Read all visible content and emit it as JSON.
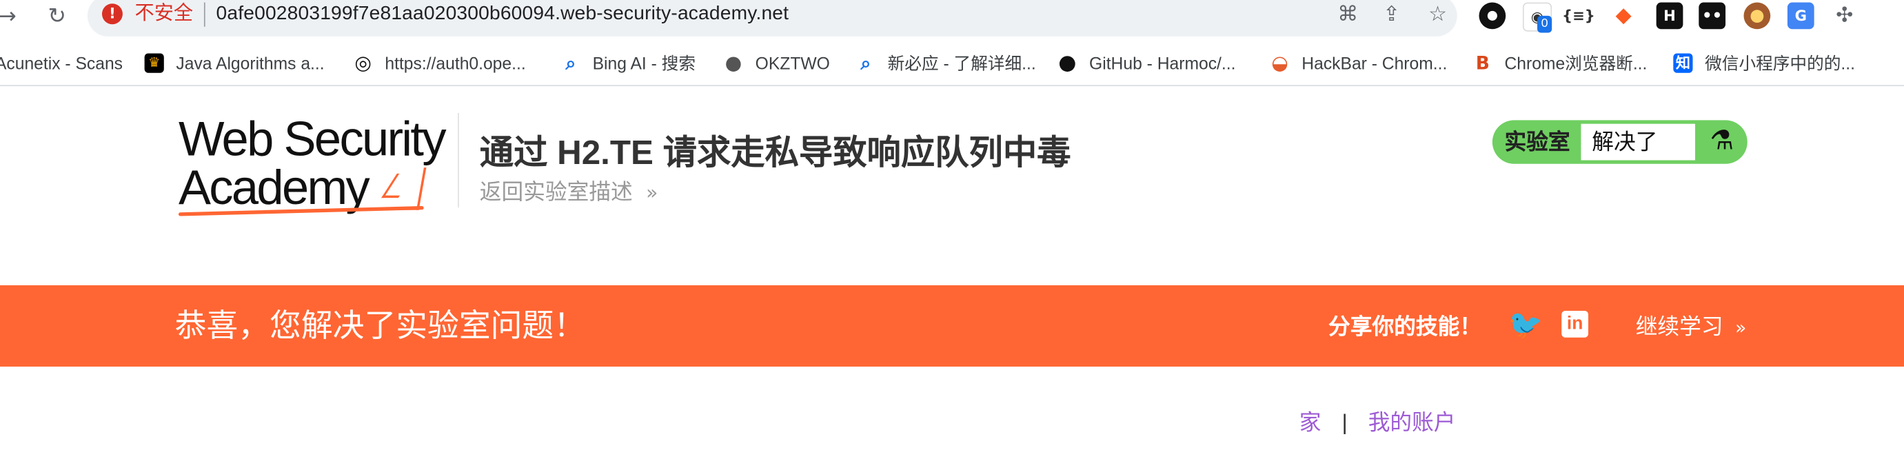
{
  "browser": {
    "icons": {
      "forward": "→",
      "refresh": "↻",
      "insecure": "!",
      "translate": "⌘",
      "share": "⇪",
      "star": "☆"
    },
    "security_label": "不安全",
    "url": "0afe002803199f7e81aa020300b60094.web-security-academy.net",
    "extensions": {
      "robot_badge": "0",
      "json": "{≡}",
      "fox": "◆",
      "h": "H",
      "dots": "••",
      "cookie": "●",
      "google": "G",
      "puzzle": "✣",
      "more": "⋮"
    }
  },
  "bookmarks": [
    {
      "label": "Acunetix - Scans",
      "icon": ""
    },
    {
      "label": "Java Algorithms a...",
      "icon": "♛"
    },
    {
      "label": "https://auth0.ope...",
      "icon": "◎"
    },
    {
      "label": "Bing AI - 搜索",
      "icon": "⌕"
    },
    {
      "label": "OKZTWO",
      "icon": "●"
    },
    {
      "label": "新必应 - 了解详细...",
      "icon": "⌕"
    },
    {
      "label": "GitHub - Harmoc/...",
      "icon": "●"
    },
    {
      "label": "HackBar - Chrom...",
      "icon": "◒"
    },
    {
      "label": "Chrome浏览器断...",
      "icon": "B"
    },
    {
      "label": "微信小程序中的的...",
      "icon": "知"
    }
  ],
  "page": {
    "logo": {
      "line1": "Web Security",
      "line2": "Academy"
    },
    "title": "通过 H2.TE 请求走私导致响应队列中毒",
    "back_link": "返回实验室描述",
    "back_icon": "»",
    "lab_status": {
      "label": "实验室",
      "value": "解决了",
      "flask_icon": "⚗"
    },
    "banner": {
      "message": "恭喜，您解决了实验室问题！",
      "share_label": "分享你的技能！",
      "twitter_icon": "🐦",
      "linkedin_icon": "in",
      "continue_label": "继续学习",
      "continue_icon": "»"
    },
    "footer_links": {
      "home": "家",
      "separator": "|",
      "account": "我的账户"
    }
  },
  "colors": {
    "accent_orange": "#ff6633",
    "success_green": "#6fcf61",
    "link_purple": "#9d5bd4",
    "insecure_red": "#d93025"
  }
}
